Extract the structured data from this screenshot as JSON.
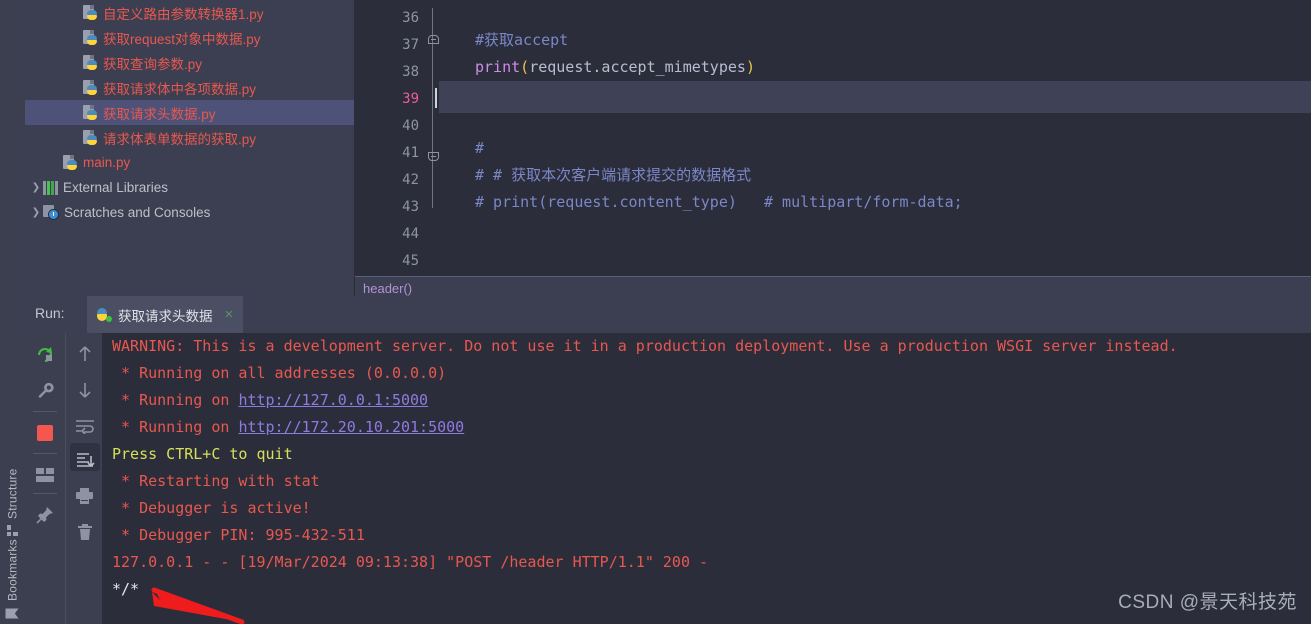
{
  "project_tree": {
    "items": [
      {
        "label": "自定义路由参数转换器1.py",
        "icon": "python-file-icon",
        "indent": 2,
        "selected": false,
        "expandable": false,
        "type": "py"
      },
      {
        "label": "获取request对象中数据.py",
        "icon": "python-file-icon",
        "indent": 2,
        "selected": false,
        "expandable": false,
        "type": "py"
      },
      {
        "label": "获取查询参数.py",
        "icon": "python-file-icon",
        "indent": 2,
        "selected": false,
        "expandable": false,
        "type": "py"
      },
      {
        "label": "获取请求体中各项数据.py",
        "icon": "python-file-icon",
        "indent": 2,
        "selected": false,
        "expandable": false,
        "type": "py"
      },
      {
        "label": "获取请求头数据.py",
        "icon": "python-file-icon",
        "indent": 2,
        "selected": true,
        "expandable": false,
        "type": "py"
      },
      {
        "label": "请求体表单数据的获取.py",
        "icon": "python-file-icon",
        "indent": 2,
        "selected": false,
        "expandable": false,
        "type": "py"
      },
      {
        "label": "main.py",
        "icon": "python-file-icon",
        "indent": 1,
        "selected": false,
        "expandable": false,
        "type": "py"
      },
      {
        "label": "External Libraries",
        "icon": "library-icon",
        "indent": 0,
        "selected": false,
        "expandable": true,
        "type": "lib"
      },
      {
        "label": "Scratches and Consoles",
        "icon": "scratches-icon",
        "indent": 0,
        "selected": false,
        "expandable": true,
        "type": "scratch"
      }
    ]
  },
  "tool_strip": {
    "structure_label": "Structure",
    "bookmarks_label": "Bookmarks"
  },
  "editor": {
    "lines": [
      {
        "num": "36",
        "text": "",
        "current": false,
        "fold": ""
      },
      {
        "num": "37",
        "text": "#获取accept",
        "current": false,
        "fold": "top"
      },
      {
        "num": "38",
        "text": "print(request.accept_mimetypes)",
        "current": false,
        "fold": ""
      },
      {
        "num": "39",
        "text": "",
        "current": true,
        "fold": ""
      },
      {
        "num": "40",
        "text": "",
        "current": false,
        "fold": ""
      },
      {
        "num": "41",
        "text": "#",
        "current": false,
        "fold": "bottom"
      },
      {
        "num": "42",
        "text": "# # 获取本次客户端请求提交的数据格式",
        "current": false,
        "fold": ""
      },
      {
        "num": "43",
        "text": "# print(request.content_type)   # multipart/form-data;",
        "current": false,
        "fold": ""
      },
      {
        "num": "44",
        "text": "",
        "current": false,
        "fold": ""
      },
      {
        "num": "45",
        "text": "",
        "current": false,
        "fold": ""
      }
    ],
    "breadcrumb": "header()"
  },
  "run_panel": {
    "run_label": "Run:",
    "tab_title": "获取请求头数据",
    "close_label": "×",
    "toolbar_left": [
      "rerun-icon",
      "settings-wrench-icon",
      "stop-icon",
      "layout-icon",
      "pin-icon"
    ],
    "toolbar_right": [
      "scroll-up-icon",
      "scroll-down-icon",
      "soft-wrap-icon",
      "scroll-to-end-icon",
      "print-icon",
      "trash-icon"
    ],
    "output": [
      {
        "type": "warn",
        "segments": [
          {
            "t": "WARNING: This is a development server. Do not use it in a production deployment. Use a production WSGI server instead.",
            "k": "warn"
          }
        ]
      },
      {
        "type": "warn",
        "segments": [
          {
            "t": " * Running on all addresses (0.0.0.0)",
            "k": "warn"
          }
        ]
      },
      {
        "type": "warn",
        "segments": [
          {
            "t": " * Running on ",
            "k": "warn"
          },
          {
            "t": "http://127.0.0.1:5000",
            "k": "link"
          }
        ]
      },
      {
        "type": "warn",
        "segments": [
          {
            "t": " * Running on ",
            "k": "warn"
          },
          {
            "t": "http://172.20.10.201:5000",
            "k": "link"
          }
        ]
      },
      {
        "type": "quit",
        "segments": [
          {
            "t": "Press CTRL+C to quit",
            "k": "quit"
          }
        ]
      },
      {
        "type": "warn",
        "segments": [
          {
            "t": " * Restarting with stat",
            "k": "warn"
          }
        ]
      },
      {
        "type": "warn",
        "segments": [
          {
            "t": " * Debugger is active!",
            "k": "warn"
          }
        ]
      },
      {
        "type": "warn",
        "segments": [
          {
            "t": " * Debugger PIN: 995-432-511",
            "k": "warn"
          }
        ]
      },
      {
        "type": "warn",
        "segments": [
          {
            "t": "127.0.0.1 - - [19/Mar/2024 09:13:38] \"POST /header HTTP/1.1\" 200 -",
            "k": "warn"
          }
        ]
      },
      {
        "type": "plain",
        "segments": [
          {
            "t": "*/*",
            "k": "white"
          }
        ]
      }
    ]
  },
  "annotation": {
    "shape": "red-arrow",
    "color": "#ee1c1c"
  },
  "watermark": {
    "text": "CSDN @景天科技苑"
  },
  "colors": {
    "editor_bg": "#2b2d3a",
    "panel_bg": "#3c3f51",
    "selection": "#4e5279",
    "current_line": "#3f4257",
    "file_label": "#e8584f",
    "console_red": "#e8584f",
    "console_yellow": "#d7e05a",
    "link": "#8f7ae0",
    "comment": "#7b87c7",
    "keyword": "#cf8ee6"
  }
}
